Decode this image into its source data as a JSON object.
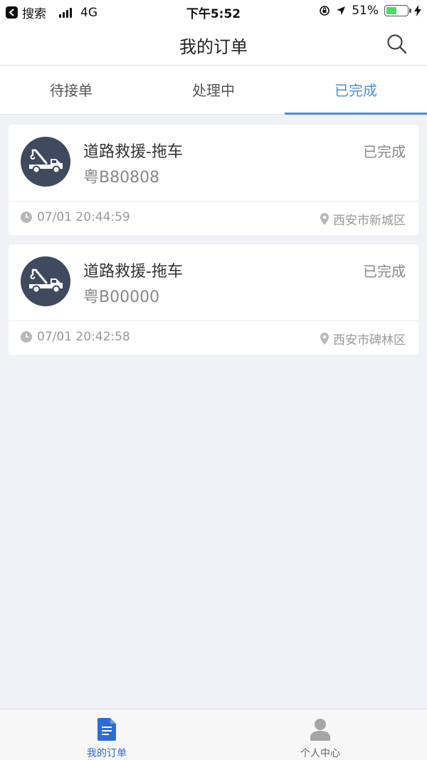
{
  "status_bar": {
    "back_app_label": "搜索",
    "network": "4G",
    "time": "下午5:52",
    "battery": "51%",
    "battery_level": 0.51
  },
  "nav": {
    "title": "我的订单",
    "search_icon": "search-icon"
  },
  "tabs": [
    {
      "label": "待接单",
      "active": false
    },
    {
      "label": "处理中",
      "active": false
    },
    {
      "label": "已完成",
      "active": true
    }
  ],
  "orders": [
    {
      "service": "道路救援-拖车",
      "plate": "粤B80808",
      "status": "已完成",
      "time": "07/01 20:44:59",
      "location": "西安市新城区",
      "icon": "tow-truck-icon"
    },
    {
      "service": "道路救援-拖车",
      "plate": "粤B00000",
      "status": "已完成",
      "time": "07/01 20:42:58",
      "location": "西安市碑林区",
      "icon": "tow-truck-icon"
    }
  ],
  "bottom_tabs": [
    {
      "label": "我的订单",
      "icon": "document-icon",
      "active": true
    },
    {
      "label": "个人中心",
      "icon": "person-icon",
      "active": false
    }
  ],
  "colors": {
    "accent": "#4a90d9",
    "bottom_active": "#2f6bd6",
    "avatar_bg": "#3f4a5e",
    "page_bg": "#f1f2f5",
    "battery": "#4cd964"
  }
}
